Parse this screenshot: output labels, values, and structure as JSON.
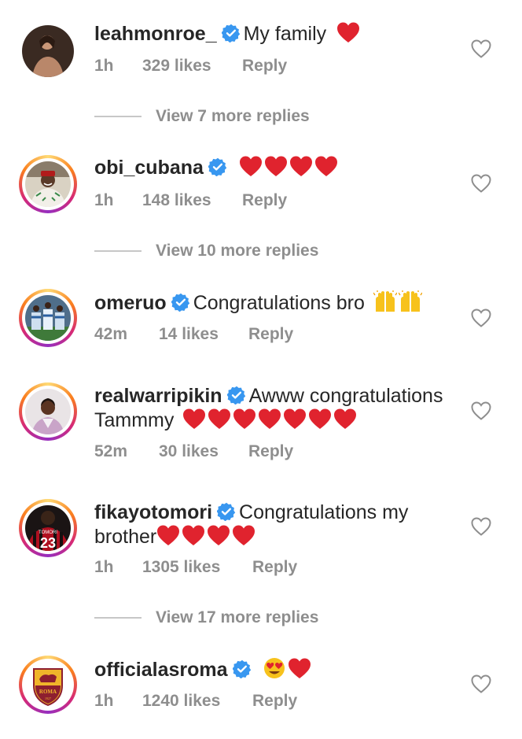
{
  "colors": {
    "text": "#262626",
    "meta": "#8e8e8e",
    "verified": "#3897f0",
    "heart": "#e0232e"
  },
  "icons": {
    "verified": "verified-badge-icon",
    "heart": "red-heart-emoji",
    "like": "heart-outline-icon",
    "raised_hands": "raising-hands-emoji",
    "heart_eyes": "heart-eyes-emoji"
  },
  "comments": [
    {
      "username": "leahmonroe_",
      "text": "My family",
      "time": "1h",
      "likes": "329 likes",
      "reply": "Reply"
    },
    {
      "username": "obi_cubana",
      "text": "",
      "time": "1h",
      "likes": "148 likes",
      "reply": "Reply"
    },
    {
      "username": "omeruo",
      "text": "Congratulations bro",
      "time": "42m",
      "likes": "14 likes",
      "reply": "Reply"
    },
    {
      "username": "realwarripikin",
      "text": "Awww congratulations",
      "text2": "Tammmy",
      "time": "52m",
      "likes": "30 likes",
      "reply": "Reply"
    },
    {
      "username": "fikayotomori",
      "text": "Congratulations my",
      "text2": "brother",
      "time": "1h",
      "likes": "1305 likes",
      "reply": "Reply"
    },
    {
      "username": "officialasroma",
      "text": "",
      "time": "1h",
      "likes": "1240 likes",
      "reply": "Reply"
    }
  ],
  "view_replies": [
    {
      "label": "View 7 more replies"
    },
    {
      "label": "View 10 more replies"
    },
    {
      "label": "View 17 more replies"
    }
  ],
  "avatar_text": {
    "roma_name": "ROMA",
    "roma_year": "1927",
    "jersey_number": "23",
    "jersey_name": "TOMORI"
  }
}
